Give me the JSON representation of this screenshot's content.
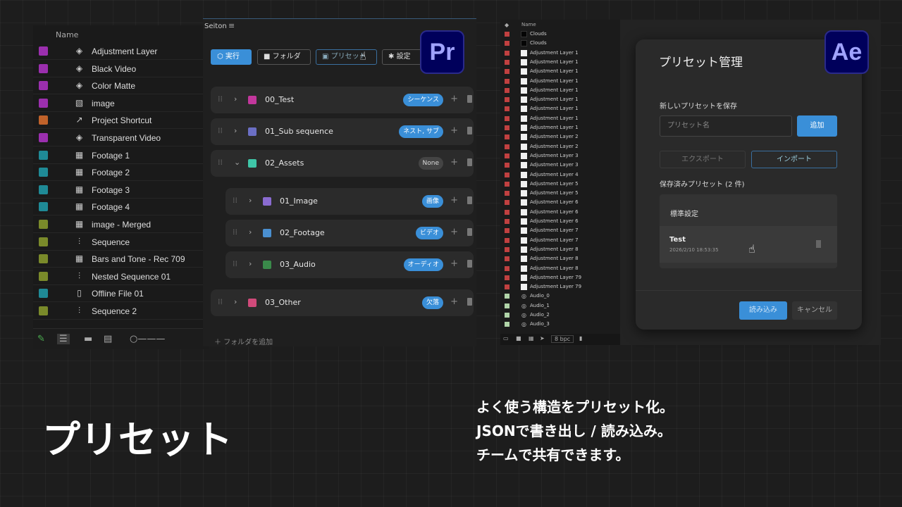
{
  "premiere": {
    "name_header": "Name",
    "items": [
      {
        "label": "Adjustment Layer",
        "color": "#9b2fae",
        "icon": "adjustment-icon"
      },
      {
        "label": "Black Video",
        "color": "#9b2fae",
        "icon": "adjustment-icon"
      },
      {
        "label": "Color Matte",
        "color": "#9b2fae",
        "icon": "adjustment-icon"
      },
      {
        "label": "image",
        "color": "#9b2fae",
        "icon": "image-icon"
      },
      {
        "label": "Project Shortcut",
        "color": "#c0622a",
        "icon": "shortcut-icon"
      },
      {
        "label": "Transparent Video",
        "color": "#9b2fae",
        "icon": "adjustment-icon"
      },
      {
        "label": "Footage 1",
        "color": "#1f8a96",
        "icon": "footage-icon"
      },
      {
        "label": "Footage 2",
        "color": "#1f8a96",
        "icon": "footage-icon"
      },
      {
        "label": "Footage 3",
        "color": "#1f8a96",
        "icon": "footage-icon"
      },
      {
        "label": "Footage 4",
        "color": "#1f8a96",
        "icon": "footage-icon"
      },
      {
        "label": "image - Merged",
        "color": "#7a8a2a",
        "icon": "footage-icon"
      },
      {
        "label": "Sequence",
        "color": "#7a8a2a",
        "icon": "sequence-icon"
      },
      {
        "label": "Bars and Tone - Rec 709",
        "color": "#7a8a2a",
        "icon": "footage-icon"
      },
      {
        "label": "Nested Sequence 01",
        "color": "#7a8a2a",
        "icon": "sequence-icon"
      },
      {
        "label": "Offline File 01",
        "color": "#1f8a96",
        "icon": "offline-icon"
      },
      {
        "label": "Sequence 2",
        "color": "#7a8a2a",
        "icon": "sequence-icon"
      }
    ]
  },
  "seiton": {
    "title": "Seiton",
    "menu_icon": "≡",
    "toolbar": {
      "run": "実行",
      "folder": "フォルダ",
      "preset": "プリセット",
      "settings": "設定"
    },
    "folders": [
      {
        "label": "00_Test",
        "color": "#c2379c",
        "tag": "シーケンス",
        "tag_style": "blue",
        "level": 0,
        "chevron": "›"
      },
      {
        "label": "01_Sub sequence",
        "color": "#6b6fc4",
        "tag": "ネスト, サブ",
        "tag_style": "blue",
        "level": 0,
        "chevron": "›"
      },
      {
        "label": "02_Assets",
        "color": "#3fc6a8",
        "tag": "None",
        "tag_style": "gray",
        "level": 0,
        "chevron": "⌄"
      },
      {
        "label": "01_Image",
        "color": "#8a6bd0",
        "tag": "画像",
        "tag_style": "blue",
        "level": 1,
        "chevron": "›"
      },
      {
        "label": "02_Footage",
        "color": "#4a8fd0",
        "tag": "ビデオ",
        "tag_style": "blue",
        "level": 1,
        "chevron": "›"
      },
      {
        "label": "03_Audio",
        "color": "#3a8a4a",
        "tag": "オーディオ",
        "tag_style": "blue",
        "level": 1,
        "chevron": "›"
      },
      {
        "label": "03_Other",
        "color": "#d04a7a",
        "tag": "欠落",
        "tag_style": "blue",
        "level": 0,
        "chevron": "›"
      }
    ],
    "add_folder": "フォルダを追加"
  },
  "badges": {
    "pr": "Pr",
    "ae": "Ae"
  },
  "ae": {
    "name_header": "Name",
    "layers": [
      {
        "label": "Clouds",
        "color": "#c04040",
        "swatch": "black"
      },
      {
        "label": "Clouds",
        "color": "#c04040",
        "swatch": "black"
      },
      {
        "label": "Adjustment Layer 1",
        "color": "#c04040",
        "swatch": "white"
      },
      {
        "label": "Adjustment Layer 1",
        "color": "#c04040",
        "swatch": "white"
      },
      {
        "label": "Adjustment Layer 1",
        "color": "#c04040",
        "swatch": "white"
      },
      {
        "label": "Adjustment Layer 1",
        "color": "#c04040",
        "swatch": "white"
      },
      {
        "label": "Adjustment Layer 1",
        "color": "#c04040",
        "swatch": "white"
      },
      {
        "label": "Adjustment Layer 1",
        "color": "#c04040",
        "swatch": "white"
      },
      {
        "label": "Adjustment Layer 1",
        "color": "#c04040",
        "swatch": "white"
      },
      {
        "label": "Adjustment Layer 1",
        "color": "#c04040",
        "swatch": "white"
      },
      {
        "label": "Adjustment Layer 1",
        "color": "#c04040",
        "swatch": "white"
      },
      {
        "label": "Adjustment Layer 2",
        "color": "#c04040",
        "swatch": "white"
      },
      {
        "label": "Adjustment Layer 2",
        "color": "#c04040",
        "swatch": "white"
      },
      {
        "label": "Adjustment Layer 3",
        "color": "#c04040",
        "swatch": "white"
      },
      {
        "label": "Adjustment Layer 3",
        "color": "#c04040",
        "swatch": "white"
      },
      {
        "label": "Adjustment Layer 4",
        "color": "#c04040",
        "swatch": "white"
      },
      {
        "label": "Adjustment Layer 5",
        "color": "#c04040",
        "swatch": "white"
      },
      {
        "label": "Adjustment Layer 5",
        "color": "#c04040",
        "swatch": "white"
      },
      {
        "label": "Adjustment Layer 6",
        "color": "#c04040",
        "swatch": "white"
      },
      {
        "label": "Adjustment Layer 6",
        "color": "#c04040",
        "swatch": "white"
      },
      {
        "label": "Adjustment Layer 6",
        "color": "#c04040",
        "swatch": "white"
      },
      {
        "label": "Adjustment Layer 7",
        "color": "#c04040",
        "swatch": "white"
      },
      {
        "label": "Adjustment Layer 7",
        "color": "#c04040",
        "swatch": "white"
      },
      {
        "label": "Adjustment Layer 8",
        "color": "#c04040",
        "swatch": "white"
      },
      {
        "label": "Adjustment Layer 8",
        "color": "#c04040",
        "swatch": "white"
      },
      {
        "label": "Adjustment Layer 8",
        "color": "#c04040",
        "swatch": "white"
      },
      {
        "label": "Adjustment Layer 79",
        "color": "#c04040",
        "swatch": "white"
      },
      {
        "label": "Adjustment Layer 79",
        "color": "#c04040",
        "swatch": "white"
      },
      {
        "label": "Audio_0",
        "color": "#b0d4a8",
        "swatch": "audio"
      },
      {
        "label": "Audio_1",
        "color": "#b0d4a8",
        "swatch": "audio"
      },
      {
        "label": "Audio_2",
        "color": "#b0d4a8",
        "swatch": "audio"
      },
      {
        "label": "Audio_3",
        "color": "#b0d4a8",
        "swatch": "audio"
      }
    ],
    "footer_bpc": "8 bpc",
    "dialog": {
      "title": "プリセット管理",
      "save_section": "新しいプリセットを保存",
      "name_placeholder": "プリセット名",
      "add": "追加",
      "export": "エクスポート",
      "import": "インポート",
      "saved_section": "保存済みプリセット (2 件)",
      "presets": [
        {
          "name": "標準設定",
          "date": ""
        },
        {
          "name": "Test",
          "date": "2026/2/10 18:53:35"
        }
      ],
      "load": "読み込み",
      "cancel": "キャンセル"
    }
  },
  "caption": {
    "title": "プリセット",
    "lines": [
      "よく使う構造をプリセット化。",
      "JSONで書き出し / 読み込み。",
      "チームで共有できます。"
    ]
  }
}
